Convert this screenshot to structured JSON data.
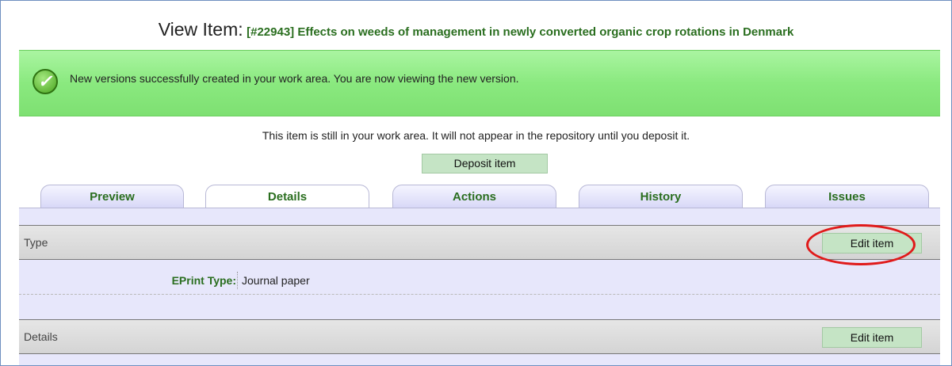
{
  "header": {
    "label": "View Item:",
    "item": "[#22943] Effects on weeds of management in newly converted organic crop rotations in Denmark"
  },
  "banner": {
    "icon": "check-icon",
    "message": "New versions successfully created in your work area. You are now viewing the new version."
  },
  "notice": {
    "text": "This item is still in your work area. It will not appear in the repository until you deposit it.",
    "deposit_label": "Deposit item"
  },
  "tabs": [
    {
      "label": "Preview",
      "active": false
    },
    {
      "label": "Details",
      "active": true
    },
    {
      "label": "Actions",
      "active": false
    },
    {
      "label": "History",
      "active": false
    },
    {
      "label": "Issues",
      "active": false
    }
  ],
  "sections": [
    {
      "title": "Type",
      "edit_label": "Edit item",
      "highlighted": true
    },
    {
      "title": "Details",
      "edit_label": "Edit item",
      "highlighted": false
    }
  ],
  "fields": {
    "eprint_type": {
      "label": "EPrint Type:",
      "value": "Journal paper"
    }
  },
  "colors": {
    "accent_green_text": "#2a6e1f",
    "banner_green": "#8ae97f",
    "button_green": "#c5e4c5",
    "tab_lavender": "#d7d7f7",
    "panel_lavender": "#e7e7fb",
    "highlight_red": "#e01a1a"
  }
}
